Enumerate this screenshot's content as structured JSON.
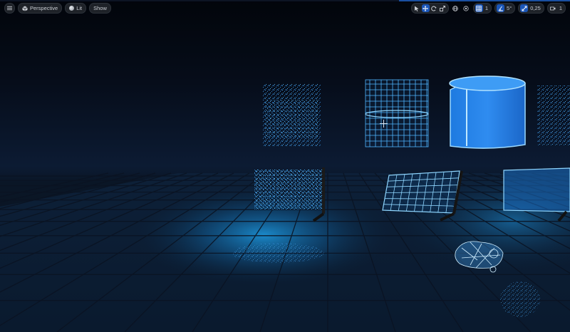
{
  "toolbar_left": {
    "menu_icon": "hamburger-icon",
    "view_mode_label": "Perspective",
    "view_mode_icon": "perspective-cube-icon",
    "lighting_label": "Lit",
    "lighting_icon": "lit-sphere-icon",
    "show_label": "Show"
  },
  "toolbar_right": {
    "transform_tools": [
      "select-icon",
      "move-icon",
      "rotate-icon",
      "scale-icon"
    ],
    "world_local_icon": "globe-icon",
    "surface_snap_icon": "surface-snap-icon",
    "grid_snap_value": "1",
    "rotation_snap_value": "5°",
    "scale_snap_value": "0,25",
    "camera_speed_value": "1"
  },
  "colors": {
    "accent": "#1b56b8",
    "hologram": "#3aa8ff",
    "floor_light": "#1a86c8",
    "background": "#03060c"
  }
}
